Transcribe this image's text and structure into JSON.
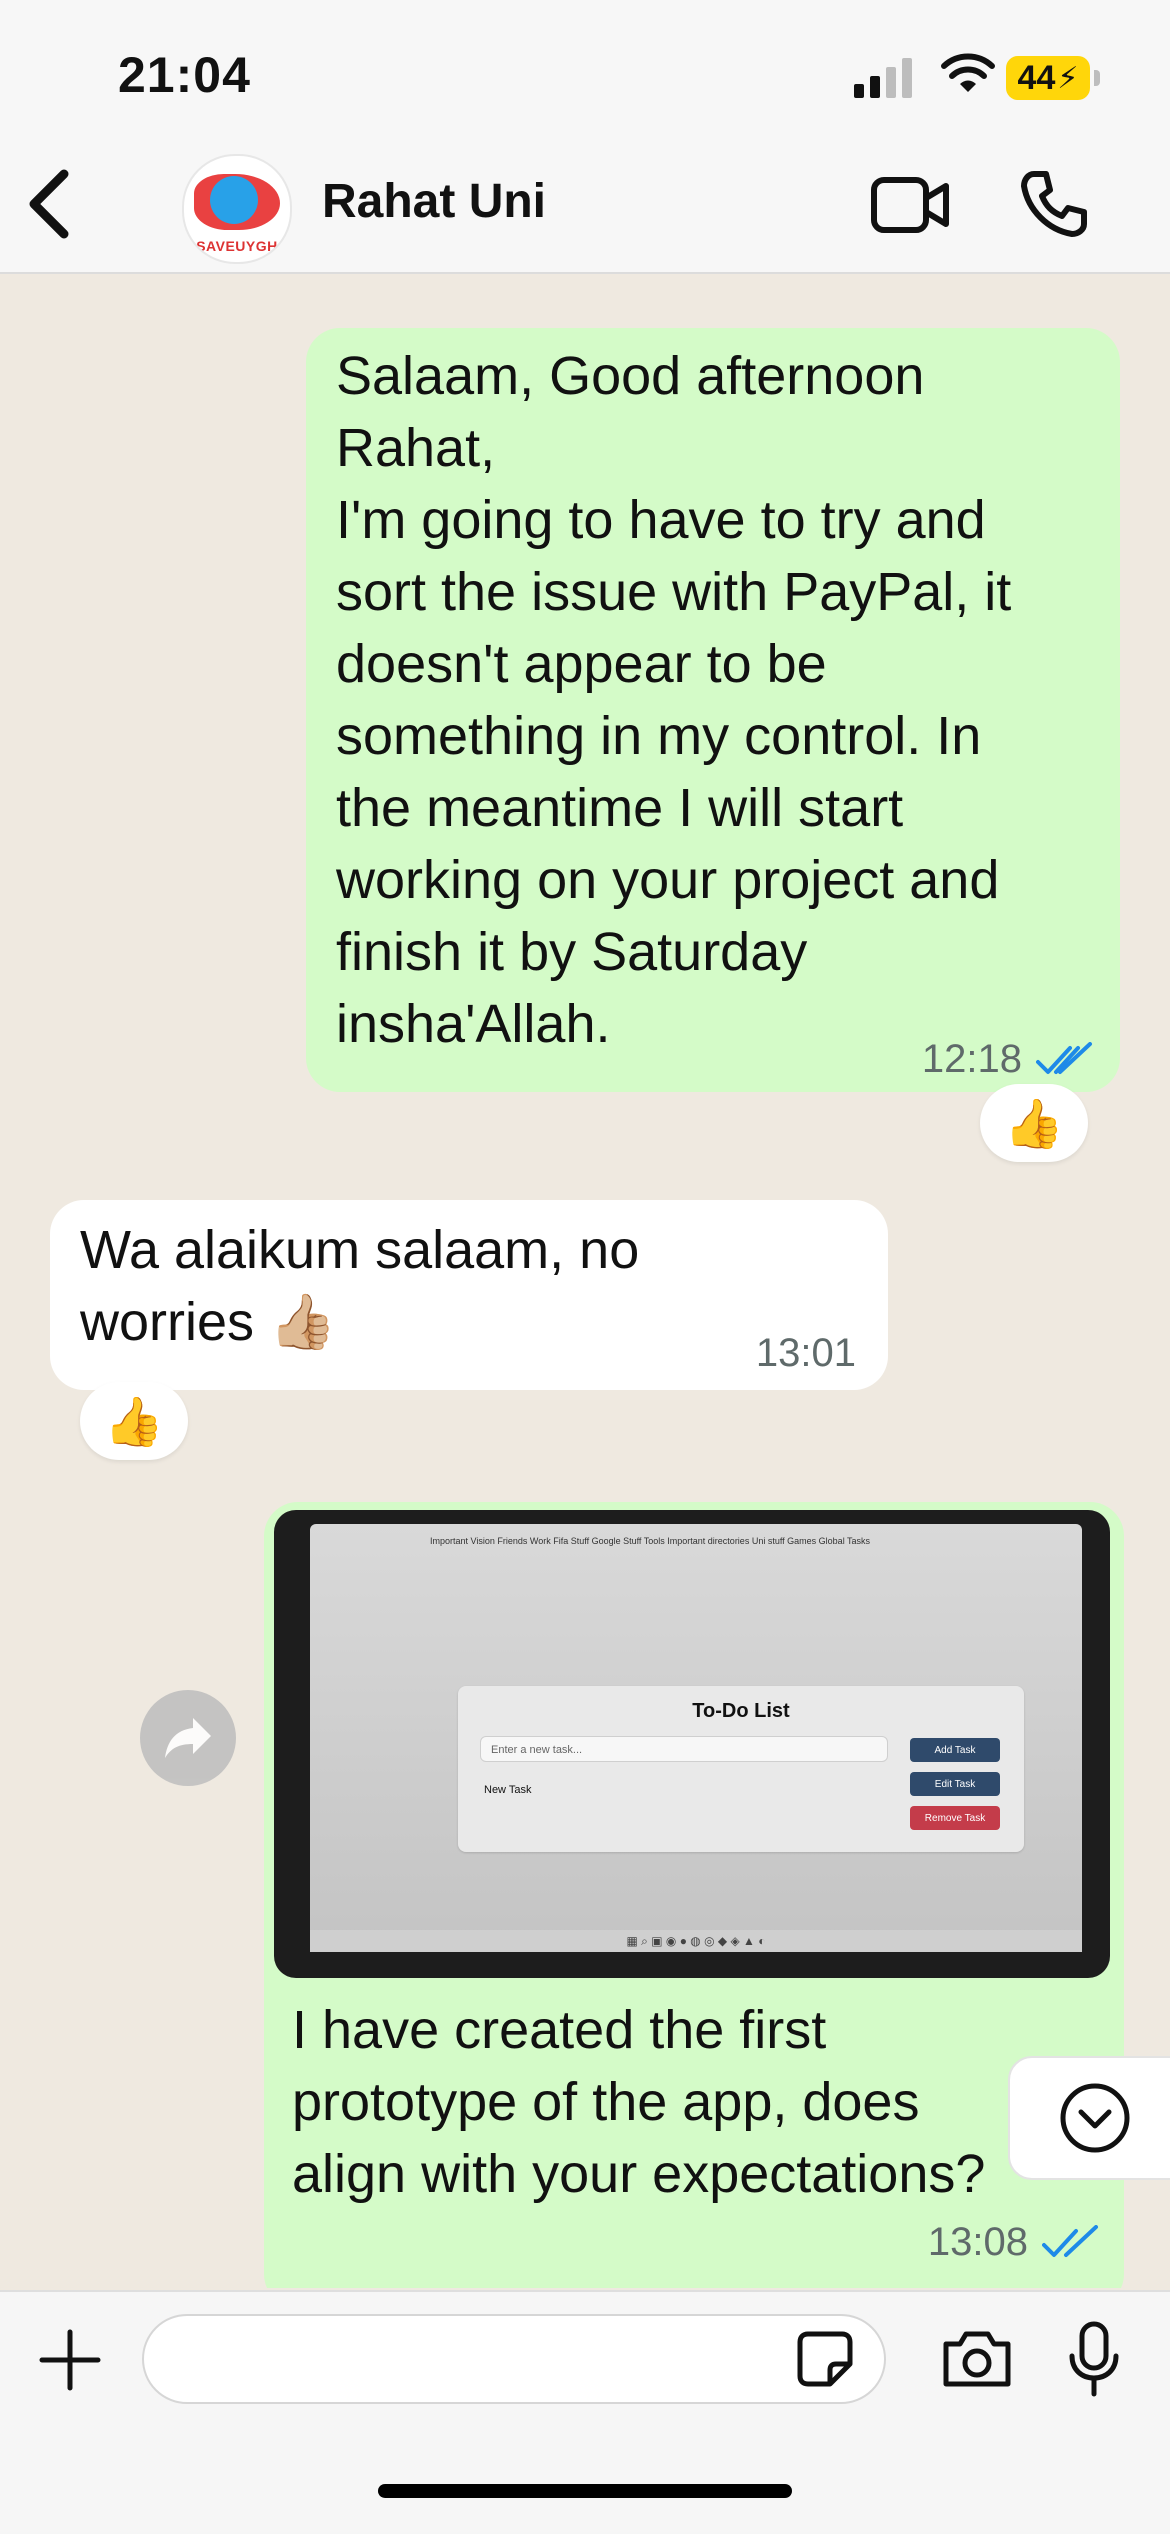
{
  "status_bar": {
    "time": "21:04",
    "battery": "44"
  },
  "header": {
    "contact_name": "Rahat Uni",
    "avatar_label": "SAVEUYGH"
  },
  "messages": [
    {
      "direction": "outgoing",
      "lines": [
        "Salaam, Good afternoon",
        "Rahat,",
        "I'm going to have to try and",
        "sort the issue with PayPal, it",
        "doesn't appear to be",
        "something in my control. In",
        "the meantime I will start",
        "working on your project and",
        "finish it by Saturday",
        "insha'Allah."
      ],
      "time": "12:18",
      "reaction": "👍"
    },
    {
      "direction": "incoming",
      "lines": [
        "Wa alaikum salaam, no",
        "worries 👍🏼"
      ],
      "time": "13:01",
      "reaction": "👍"
    },
    {
      "direction": "outgoing",
      "type": "image",
      "image": {
        "bookmarks": "Important Vision Friends  Work  Fifa Stuff  Google Stuff  Tools  Important directories  Uni stuff  Games  Global Tasks",
        "app_title": "To-Do List",
        "input_placeholder": "Enter a new task...",
        "list_item": "New Task",
        "add_button": "Add Task",
        "edit_button": "Edit Task",
        "remove_button": "Remove Task"
      },
      "lines": [
        "I have created the first",
        "prototype of the app, does",
        "align with your expectations?"
      ],
      "time": "13:08"
    }
  ],
  "colors": {
    "outgoing_bubble": "#d4fbc8",
    "incoming_bubble": "#ffffff",
    "chat_background": "#efe9e0",
    "read_ticks": "#1e8ae8",
    "battery": "#ffd60a",
    "todo_add": "#2f4a6b",
    "todo_edit": "#2f4a6b",
    "todo_remove": "#c43c4a"
  }
}
